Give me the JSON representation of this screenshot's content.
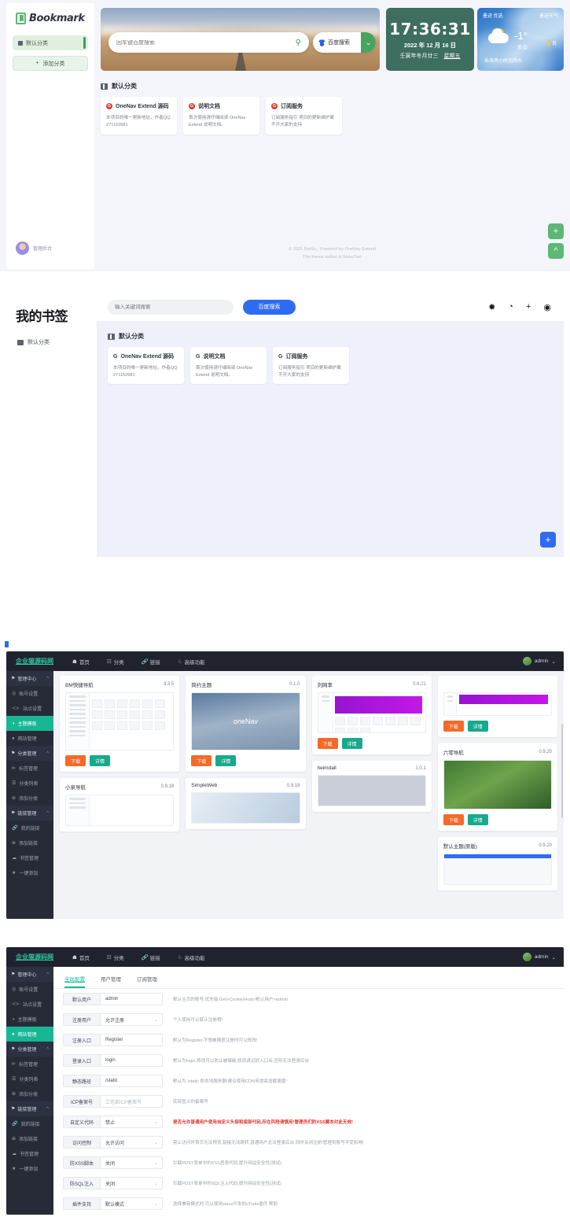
{
  "shot1": {
    "brand": "Bookmark",
    "sidebar": {
      "default_category": "默认分类",
      "add_category": "添加分类",
      "user_label": "管理后台"
    },
    "search": {
      "placeholder": "回车键百度搜索",
      "engine": "百度搜索",
      "search_icon": "search-icon",
      "caret_icon": "chevron-down-icon"
    },
    "clock": {
      "time": "17:36:31",
      "date": "2022 年 12 月 16 日",
      "lunar": "壬寅年冬月廿三",
      "weekday": "星期五"
    },
    "weather": {
      "brand_left": "墨迹 优选",
      "brand_right": "墨迹天气",
      "temp": "-1°",
      "desc": "多云",
      "aqi": "良",
      "rain": "未来两小时无降水"
    },
    "category_title": "默认分类",
    "cards": [
      {
        "title": "OneNav Extend 源码",
        "desc": "本项目的唯一更新地址，作者QQ 271152681"
      },
      {
        "title": "说明文档",
        "desc": "首次使用请仔细阅读 OneNav Extend 说明文档。"
      },
      {
        "title": "订阅服务",
        "desc": "订阅服务指引 项目的更新维护离不开大家的支持"
      }
    ],
    "footer_line1": "© 2021 BaiSu，Powered by OneNav Extend",
    "footer_line2": "The theme author is baisuTwo",
    "fab_add": "+",
    "fab_top": "^"
  },
  "shot2": {
    "title": "我的书签",
    "sidebar_category": "默认分类",
    "search": {
      "placeholder": "输入关键词搜索",
      "button": "百度搜索"
    },
    "toolbar_icons": [
      "magic-wand-icon",
      "palette-icon",
      "plus-icon",
      "user-circle-icon"
    ],
    "category_title": "默认分类",
    "cards": [
      {
        "title": "OneNav Extend 源码",
        "desc": "本项目的唯一更新地址。作者QQ 271152681"
      },
      {
        "title": "说明文档",
        "desc": "首次使用请仔细阅读 OneNav Extend 说明文档。"
      },
      {
        "title": "订阅服务",
        "desc": "订阅服务指引 项目的更新维护离不开大家的支持"
      }
    ],
    "fab_add": "+"
  },
  "admin": {
    "logo": "企业猫源码网",
    "nav": [
      {
        "icon": "home-icon",
        "label": "首页"
      },
      {
        "icon": "grid-icon",
        "label": "分类"
      },
      {
        "icon": "link-icon",
        "label": "链接"
      },
      {
        "icon": "shield-icon",
        "label": "高级功能"
      }
    ],
    "user": "admin",
    "sidebar": [
      {
        "type": "group",
        "icon": "tag-icon",
        "label": "管理中心",
        "caret": "^"
      },
      {
        "type": "item",
        "icon": "account-icon",
        "label": "账号设置"
      },
      {
        "type": "item",
        "icon": "code-icon",
        "label": "站点设置"
      },
      {
        "type": "item",
        "icon": "theme-icon",
        "label": "主题模板"
      },
      {
        "type": "item",
        "icon": "globe-icon",
        "label": "网站管理"
      },
      {
        "type": "group",
        "icon": "tag-icon",
        "label": "分类管理",
        "caret": "^"
      },
      {
        "type": "item",
        "icon": "share-icon",
        "label": "标签管理"
      },
      {
        "type": "item",
        "icon": "list-icon",
        "label": "分类列表"
      },
      {
        "type": "item",
        "icon": "plus-circle-icon",
        "label": "添加分类"
      },
      {
        "type": "group",
        "icon": "tag-icon",
        "label": "链接管理",
        "caret": "^"
      },
      {
        "type": "item",
        "icon": "link-icon",
        "label": "我的链接"
      },
      {
        "type": "item",
        "icon": "plus-circle-icon",
        "label": "添加链接"
      },
      {
        "type": "item",
        "icon": "cloud-icon",
        "label": "书签管理"
      },
      {
        "type": "item",
        "icon": "star-icon",
        "label": "一键添加"
      }
    ],
    "active_item_shot3": "主题模板",
    "active_item_shot4": "网站管理"
  },
  "themes": {
    "buttons": {
      "download": "下载",
      "detail": "详情"
    },
    "row1": [
      {
        "name": "BM快捷导航",
        "version": "3.3.5",
        "thumb": "grid"
      },
      {
        "name": "简约主题",
        "version": "0.1.0",
        "thumb": "onenav"
      },
      {
        "name": "刘网率",
        "version": "0.9.21",
        "thumb": "purple"
      }
    ],
    "row1b": {
      "name": "六零导航",
      "version": "0.9.20",
      "thumb": "green"
    },
    "row2": [
      {
        "name": "小泉导航",
        "version": "0.9.18"
      },
      {
        "name": "SimpleWeb",
        "version": "0.9.18"
      },
      {
        "name": "heimdall",
        "version": "1.0.1"
      },
      {
        "name": "默认主题(原版)",
        "version": "0.9.20"
      }
    ]
  },
  "settings": {
    "tabs": [
      {
        "label": "全局配置",
        "active": true
      },
      {
        "label": "用户管理",
        "active": false
      },
      {
        "label": "订阅管理",
        "active": false
      }
    ],
    "rows": [
      {
        "label": "默认用户",
        "value": "admin",
        "select": false,
        "hint": "默认主页的账号,优先级:Get>Cookie/Host>默认用户>admin",
        "red": false,
        "placeholder": false
      },
      {
        "label": "注册用户",
        "value": "允许注册",
        "select": true,
        "hint": "个人使用可以禁止注册哦!",
        "red": false,
        "placeholder": false
      },
      {
        "label": "注册入口",
        "value": "Register",
        "select": false,
        "hint": "默认为Register,不想被随意注册时可以修改!",
        "red": false,
        "placeholder": false
      },
      {
        "label": "登录入口",
        "value": "login",
        "select": false,
        "hint": "默认为login,修改可以防止被爆破,修改请记好入口名,否则无法登录后台",
        "red": false,
        "placeholder": false
      },
      {
        "label": "静态路径",
        "value": "/static",
        "select": false,
        "hint": "默认为 /static 即本地服务器!建议使用CDN来提高加载速度!",
        "red": false,
        "placeholder": false
      },
      {
        "label": "ICP备案号",
        "value": "工信部ICP备案号",
        "select": false,
        "hint": "底部显示的备案号",
        "red": false,
        "placeholder": true
      },
      {
        "label": "自定义代码",
        "value": "禁止",
        "select": true,
        "hint": "是否允许普通用户使用自定义头部和底部代码,存在风险请慎用!管理员们防XSS脚本对此无效!",
        "red": true,
        "placeholder": false
      },
      {
        "label": "访问控制",
        "value": "允许访问",
        "select": true,
        "hint": "禁止访问时首页无法预览,链接无法跳转,普通用户无法登录后台,同时关闭注册!管理员账号不受影响!",
        "red": false,
        "placeholder": false
      },
      {
        "label": "防XSS脚本",
        "value": "关闭",
        "select": true,
        "hint": "拦截POST表单中的XSS恶意代码,提升网站安全性(测试)",
        "red": false,
        "placeholder": false
      },
      {
        "label": "防SQL注入",
        "value": "关闭",
        "select": true,
        "hint": "拦截POST表单中的SQL注入代码,提升网站安全性(测试)",
        "red": false,
        "placeholder": false
      },
      {
        "label": "插件支持",
        "value": "默认模式",
        "select": true,
        "hint": "选择兼容模式时,可以使用xiaoz开发的uTools插件 帮助",
        "red": false,
        "placeholder": false
      }
    ]
  }
}
